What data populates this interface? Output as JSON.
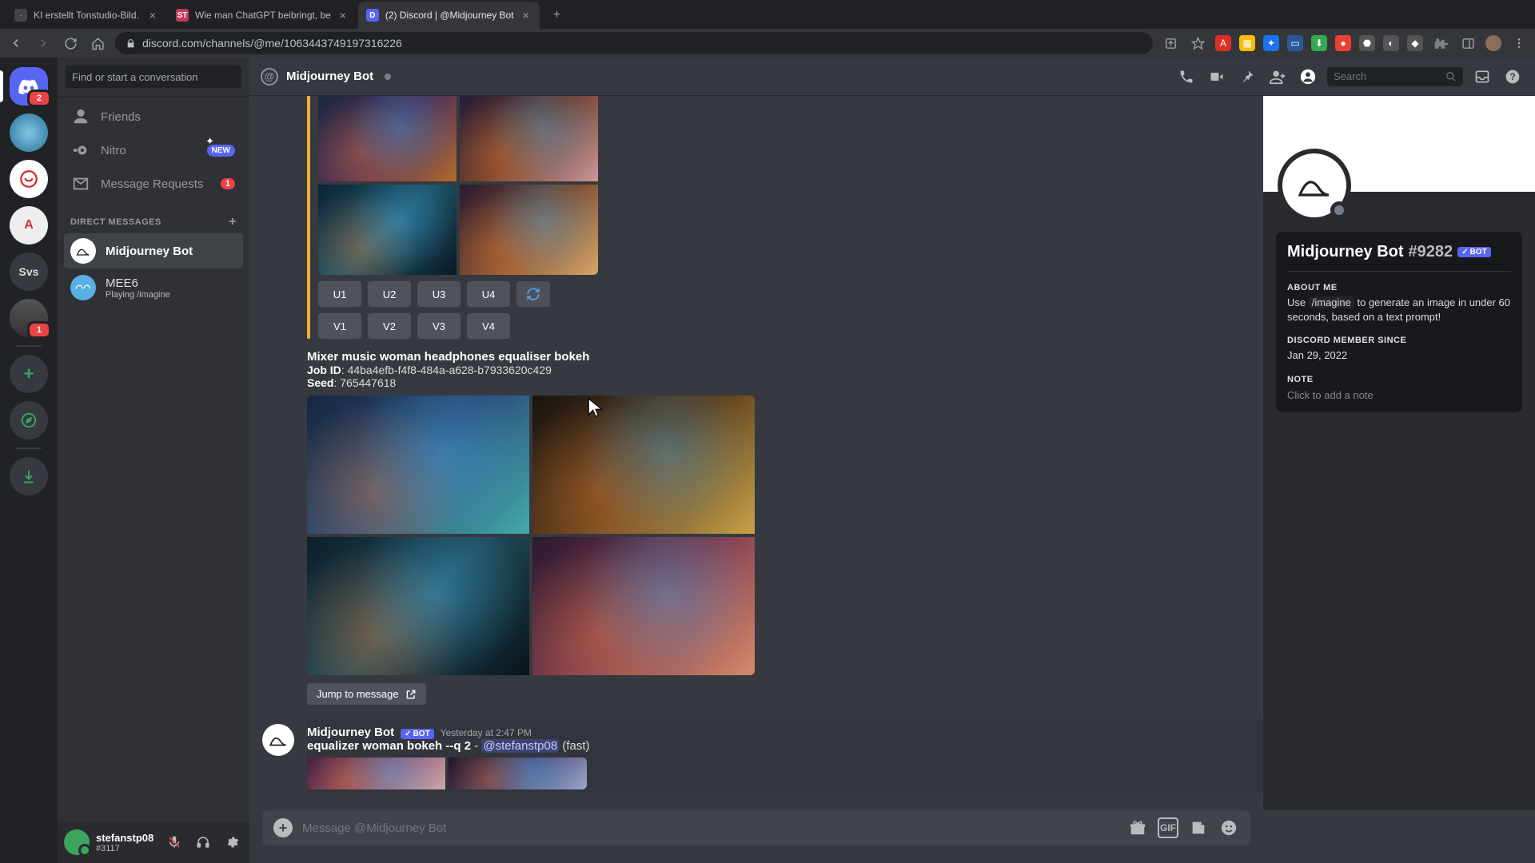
{
  "browser": {
    "tabs": [
      {
        "title": "KI erstellt Tonstudio-Bild.",
        "favicon_bg": "#444",
        "favicon_glyph": "·"
      },
      {
        "title": "Wie man ChatGPT beibringt, be",
        "favicon_bg": "#c13b5a",
        "favicon_glyph": "ST"
      },
      {
        "title": "(2) Discord | @Midjourney Bot",
        "favicon_bg": "#5865f2",
        "favicon_glyph": "D",
        "active": true
      }
    ],
    "url": "discord.com/channels/@me/1063443749197316226"
  },
  "rail": {
    "home_badge": "2",
    "servers": [
      {
        "label": "",
        "bg": "#4aa8d8"
      },
      {
        "label": "",
        "bg": "#ffffff"
      },
      {
        "label": "A",
        "bg": "#e2e2e2"
      },
      {
        "label": "Svs",
        "bg": "#36393f"
      },
      {
        "label": "",
        "bg": "#36393f",
        "badge": "1"
      }
    ]
  },
  "dm": {
    "search_placeholder": "Find or start a conversation",
    "friends_label": "Friends",
    "nitro_label": "Nitro",
    "nitro_badge": "NEW",
    "msgreq_label": "Message Requests",
    "msgreq_badge": "1",
    "header": "DIRECT MESSAGES",
    "items": [
      {
        "name": "Midjourney Bot",
        "selected": true
      },
      {
        "name": "MEE6",
        "sub": "Playing /imagine"
      }
    ]
  },
  "user": {
    "name": "stefanstp08",
    "tag": "#3117"
  },
  "chat": {
    "title": "Midjourney Bot",
    "search_placeholder": "Search",
    "u_buttons": [
      "U1",
      "U2",
      "U3",
      "U4"
    ],
    "v_buttons": [
      "V1",
      "V2",
      "V3",
      "V4"
    ],
    "prompt1_title": "Mixer music woman headphones equaliser bokeh",
    "job_id_label": "Job ID",
    "job_id_value": "44ba4efb-f4f8-484a-a628-b7933620c429",
    "seed_label": "Seed",
    "seed_value": "765447618",
    "jump_label": "Jump to message",
    "msg_author": "Midjourney Bot",
    "msg_bot_tag": "BOT",
    "msg_timestamp": "Yesterday at 2:47 PM",
    "msg_prompt_bold": "equalizer woman bokeh --q 2",
    "msg_dash": " - ",
    "msg_mention": "@stefanstp08",
    "msg_tail": " (fast)",
    "composer_placeholder": "Message @Midjourney Bot"
  },
  "profile": {
    "name": "Midjourney Bot",
    "discriminator": "#9282",
    "bot_tag": "BOT",
    "about_h": "ABOUT ME",
    "about_pre": "Use ",
    "about_cmd": "/imagine",
    "about_post": " to generate an image in under 60 seconds, based on a text prompt!",
    "since_h": "DISCORD MEMBER SINCE",
    "since_v": "Jan 29, 2022",
    "note_h": "NOTE",
    "note_placeholder": "Click to add a note"
  }
}
